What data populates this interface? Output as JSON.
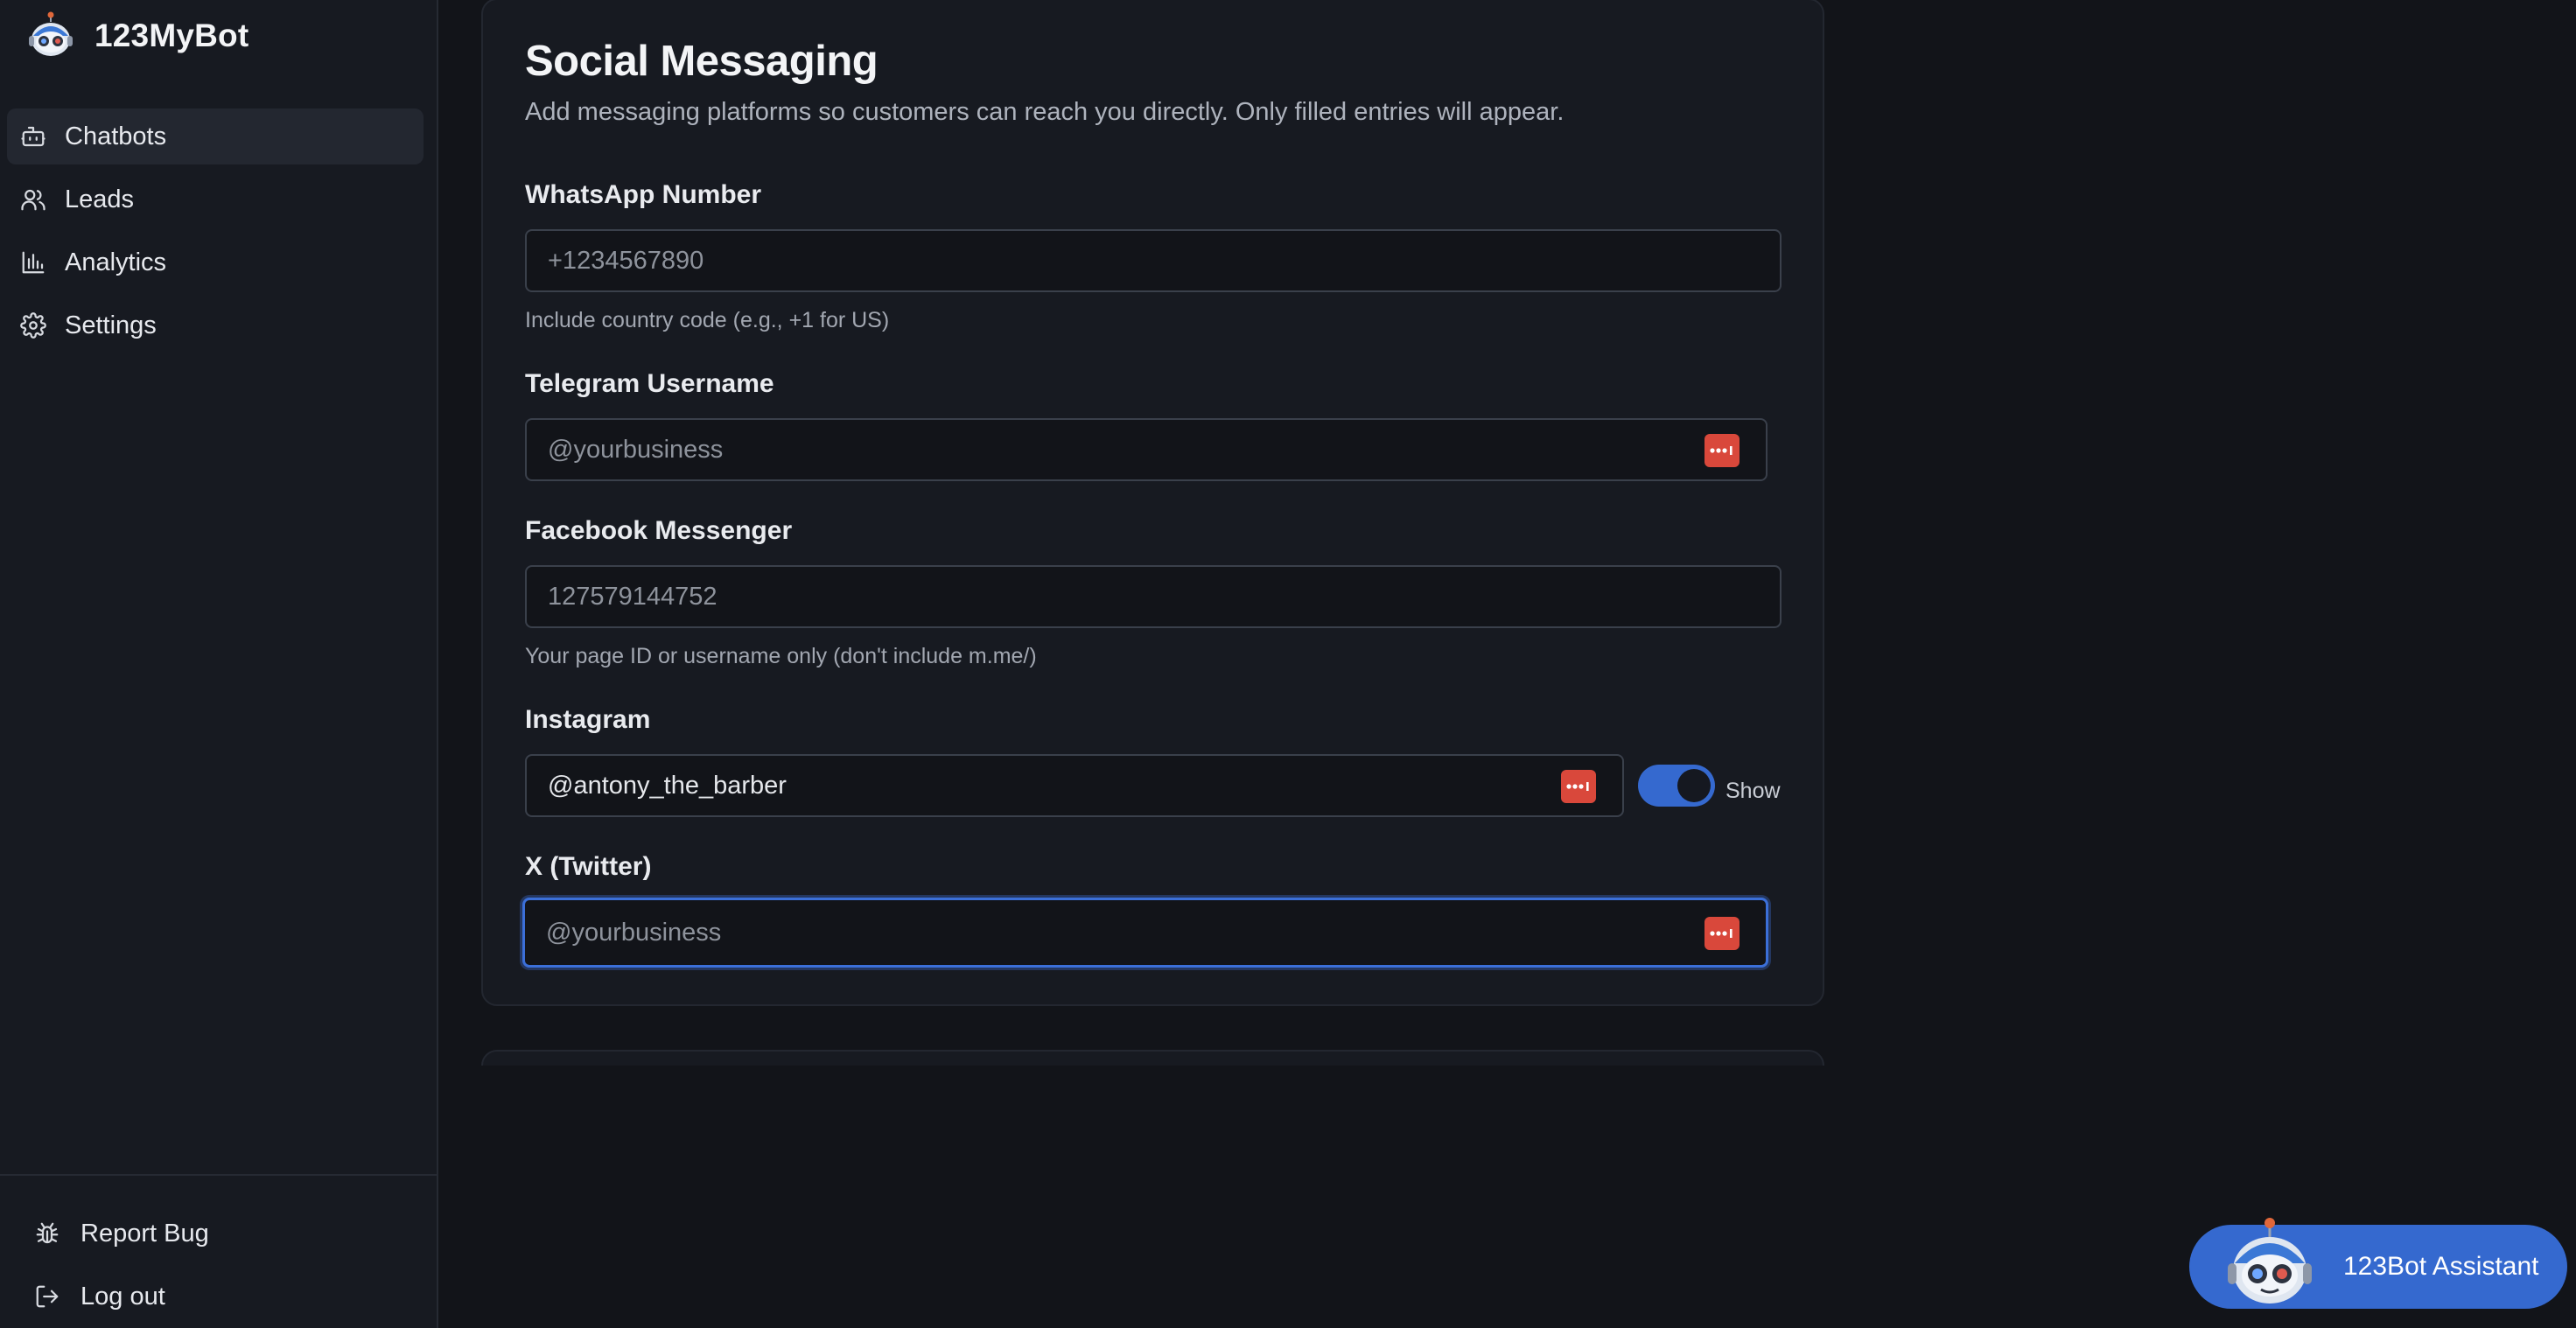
{
  "app": {
    "name": "123MyBot",
    "accent_color": "#3569cf",
    "background_color": "#121419"
  },
  "sidebar": {
    "items": [
      {
        "label": "Chatbots",
        "icon": "bot-icon",
        "active": true
      },
      {
        "label": "Leads",
        "icon": "users-icon",
        "active": false
      },
      {
        "label": "Analytics",
        "icon": "bar-chart-icon",
        "active": false
      },
      {
        "label": "Settings",
        "icon": "gear-icon",
        "active": false
      }
    ],
    "bottom": {
      "report_bug": "Report Bug",
      "logout": "Log out"
    }
  },
  "section": {
    "title": "Social Messaging",
    "subtitle": "Add messaging platforms so customers can reach you directly. Only filled entries will appear."
  },
  "fields": {
    "whatsapp": {
      "label": "WhatsApp Number",
      "value": "",
      "placeholder": "+1234567890",
      "help": "Include country code (e.g., +1 for US)"
    },
    "telegram": {
      "label": "Telegram Username",
      "value": "",
      "placeholder": "@yourbusiness"
    },
    "facebook": {
      "label": "Facebook Messenger",
      "value": "",
      "placeholder": "127579144752",
      "help": "Your page ID or username only (don't include m.me/)"
    },
    "instagram": {
      "label": "Instagram",
      "value": "@antony_the_barber",
      "placeholder": "",
      "toggle_label": "Show",
      "toggle_on": true
    },
    "twitter": {
      "label": "X (Twitter)",
      "value": "",
      "placeholder": "@yourbusiness",
      "focused": true
    }
  },
  "password_manager_icon": "password-manager-icon",
  "assistant": {
    "label": "123Bot Assistant"
  }
}
